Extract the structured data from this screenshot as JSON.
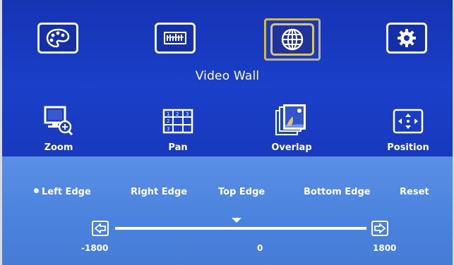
{
  "main_menu": {
    "items": [
      {
        "icon": "palette-icon"
      },
      {
        "icon": "adjust-bars-icon"
      },
      {
        "icon": "globe-icon",
        "selected": true
      },
      {
        "icon": "gear-icon"
      }
    ],
    "section_title": "Video Wall"
  },
  "sub_menu": {
    "items": [
      {
        "label": "Zoom",
        "icon": "zoom-monitor-icon"
      },
      {
        "label": "Pan",
        "icon": "pan-grid-icon"
      },
      {
        "label": "Overlap",
        "icon": "overlap-picture-icon",
        "selected": true
      },
      {
        "label": "Position",
        "icon": "position-arrows-icon"
      }
    ]
  },
  "options": [
    {
      "label": "Left Edge",
      "selected": true
    },
    {
      "label": "Right Edge"
    },
    {
      "label": "Top Edge"
    },
    {
      "label": "Bottom Edge"
    },
    {
      "label": "Reset"
    }
  ],
  "slider": {
    "min_label": "-1800",
    "max_label": "1800",
    "value_label": "0",
    "min": -1800,
    "max": 1800,
    "value": 0
  },
  "colors": {
    "top_bg": "#1a3fc9",
    "bottom_bg": "#4a82dd",
    "selection_border": "#c8b66a"
  }
}
